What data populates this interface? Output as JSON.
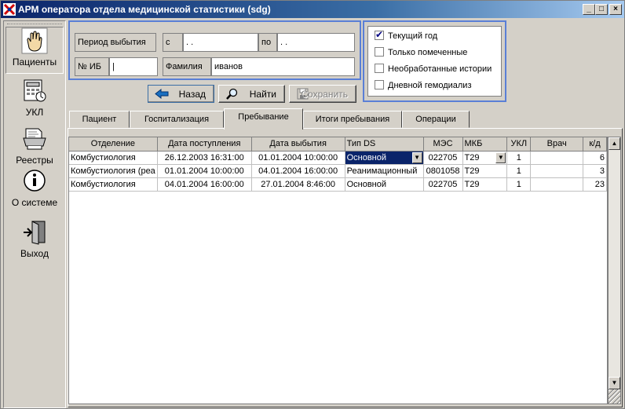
{
  "window": {
    "title": "АРМ оператора отдела медицинской статистики (sdg)",
    "minimize": "_",
    "maximize": "□",
    "close": "×"
  },
  "sidebar": {
    "items": [
      {
        "label": "Пациенты",
        "icon": "hand-icon",
        "active": true
      },
      {
        "label": "УКЛ",
        "icon": "calculator-icon"
      },
      {
        "label": "Реестры",
        "icon": "printer-icon"
      },
      {
        "label": "О системе",
        "icon": "info-icon"
      },
      {
        "label": "Выход",
        "icon": "exit-door-icon"
      }
    ]
  },
  "filter": {
    "period_label": "Период выбытия",
    "from_label": "с",
    "from_value": " . .",
    "to_label": "по",
    "to_value": " . .",
    "ib_label": "№ ИБ",
    "ib_value": "|",
    "surname_label": "Фамилия",
    "surname_value": "иванов"
  },
  "options": [
    {
      "label": "Текущий год",
      "checked": true
    },
    {
      "label": "Только помеченные",
      "checked": false
    },
    {
      "label": "Необработанные истории",
      "checked": false
    },
    {
      "label": "Дневной гемодиализ",
      "checked": false
    }
  ],
  "buttons": {
    "back": "Назад",
    "find": "Найти",
    "save": "Сохранить"
  },
  "tabs": [
    "Пациент",
    "Госпитализация",
    "Пребывание",
    "Итоги пребывания",
    "Операции"
  ],
  "table": {
    "columns": [
      "Отделение",
      "Дата поступления",
      "Дата выбытия",
      "Тип DS",
      "МЭС",
      "МКБ",
      "УКЛ",
      "Врач",
      "к/д"
    ],
    "rows": [
      [
        "Комбустиология",
        "26.12.2003 16:31:00",
        "01.01.2004 10:00:00",
        "Основной",
        "022705",
        "T29",
        "1",
        "",
        "6"
      ],
      [
        "Комбустиология (реа",
        "01.01.2004 10:00:00",
        "04.01.2004 16:00:00",
        "Реанимационный",
        "0801058",
        "T29",
        "1",
        "",
        "3"
      ],
      [
        "Комбустиология",
        "04.01.2004 16:00:00",
        "27.01.2004 8:46:00",
        "Основной",
        "022705",
        "T29",
        "1",
        "",
        "23"
      ]
    ]
  },
  "colors": {
    "titlebar": "#0a246a",
    "selection": "#0a246a",
    "panel_border": "#5a7fd6",
    "face": "#d4d0c8"
  }
}
